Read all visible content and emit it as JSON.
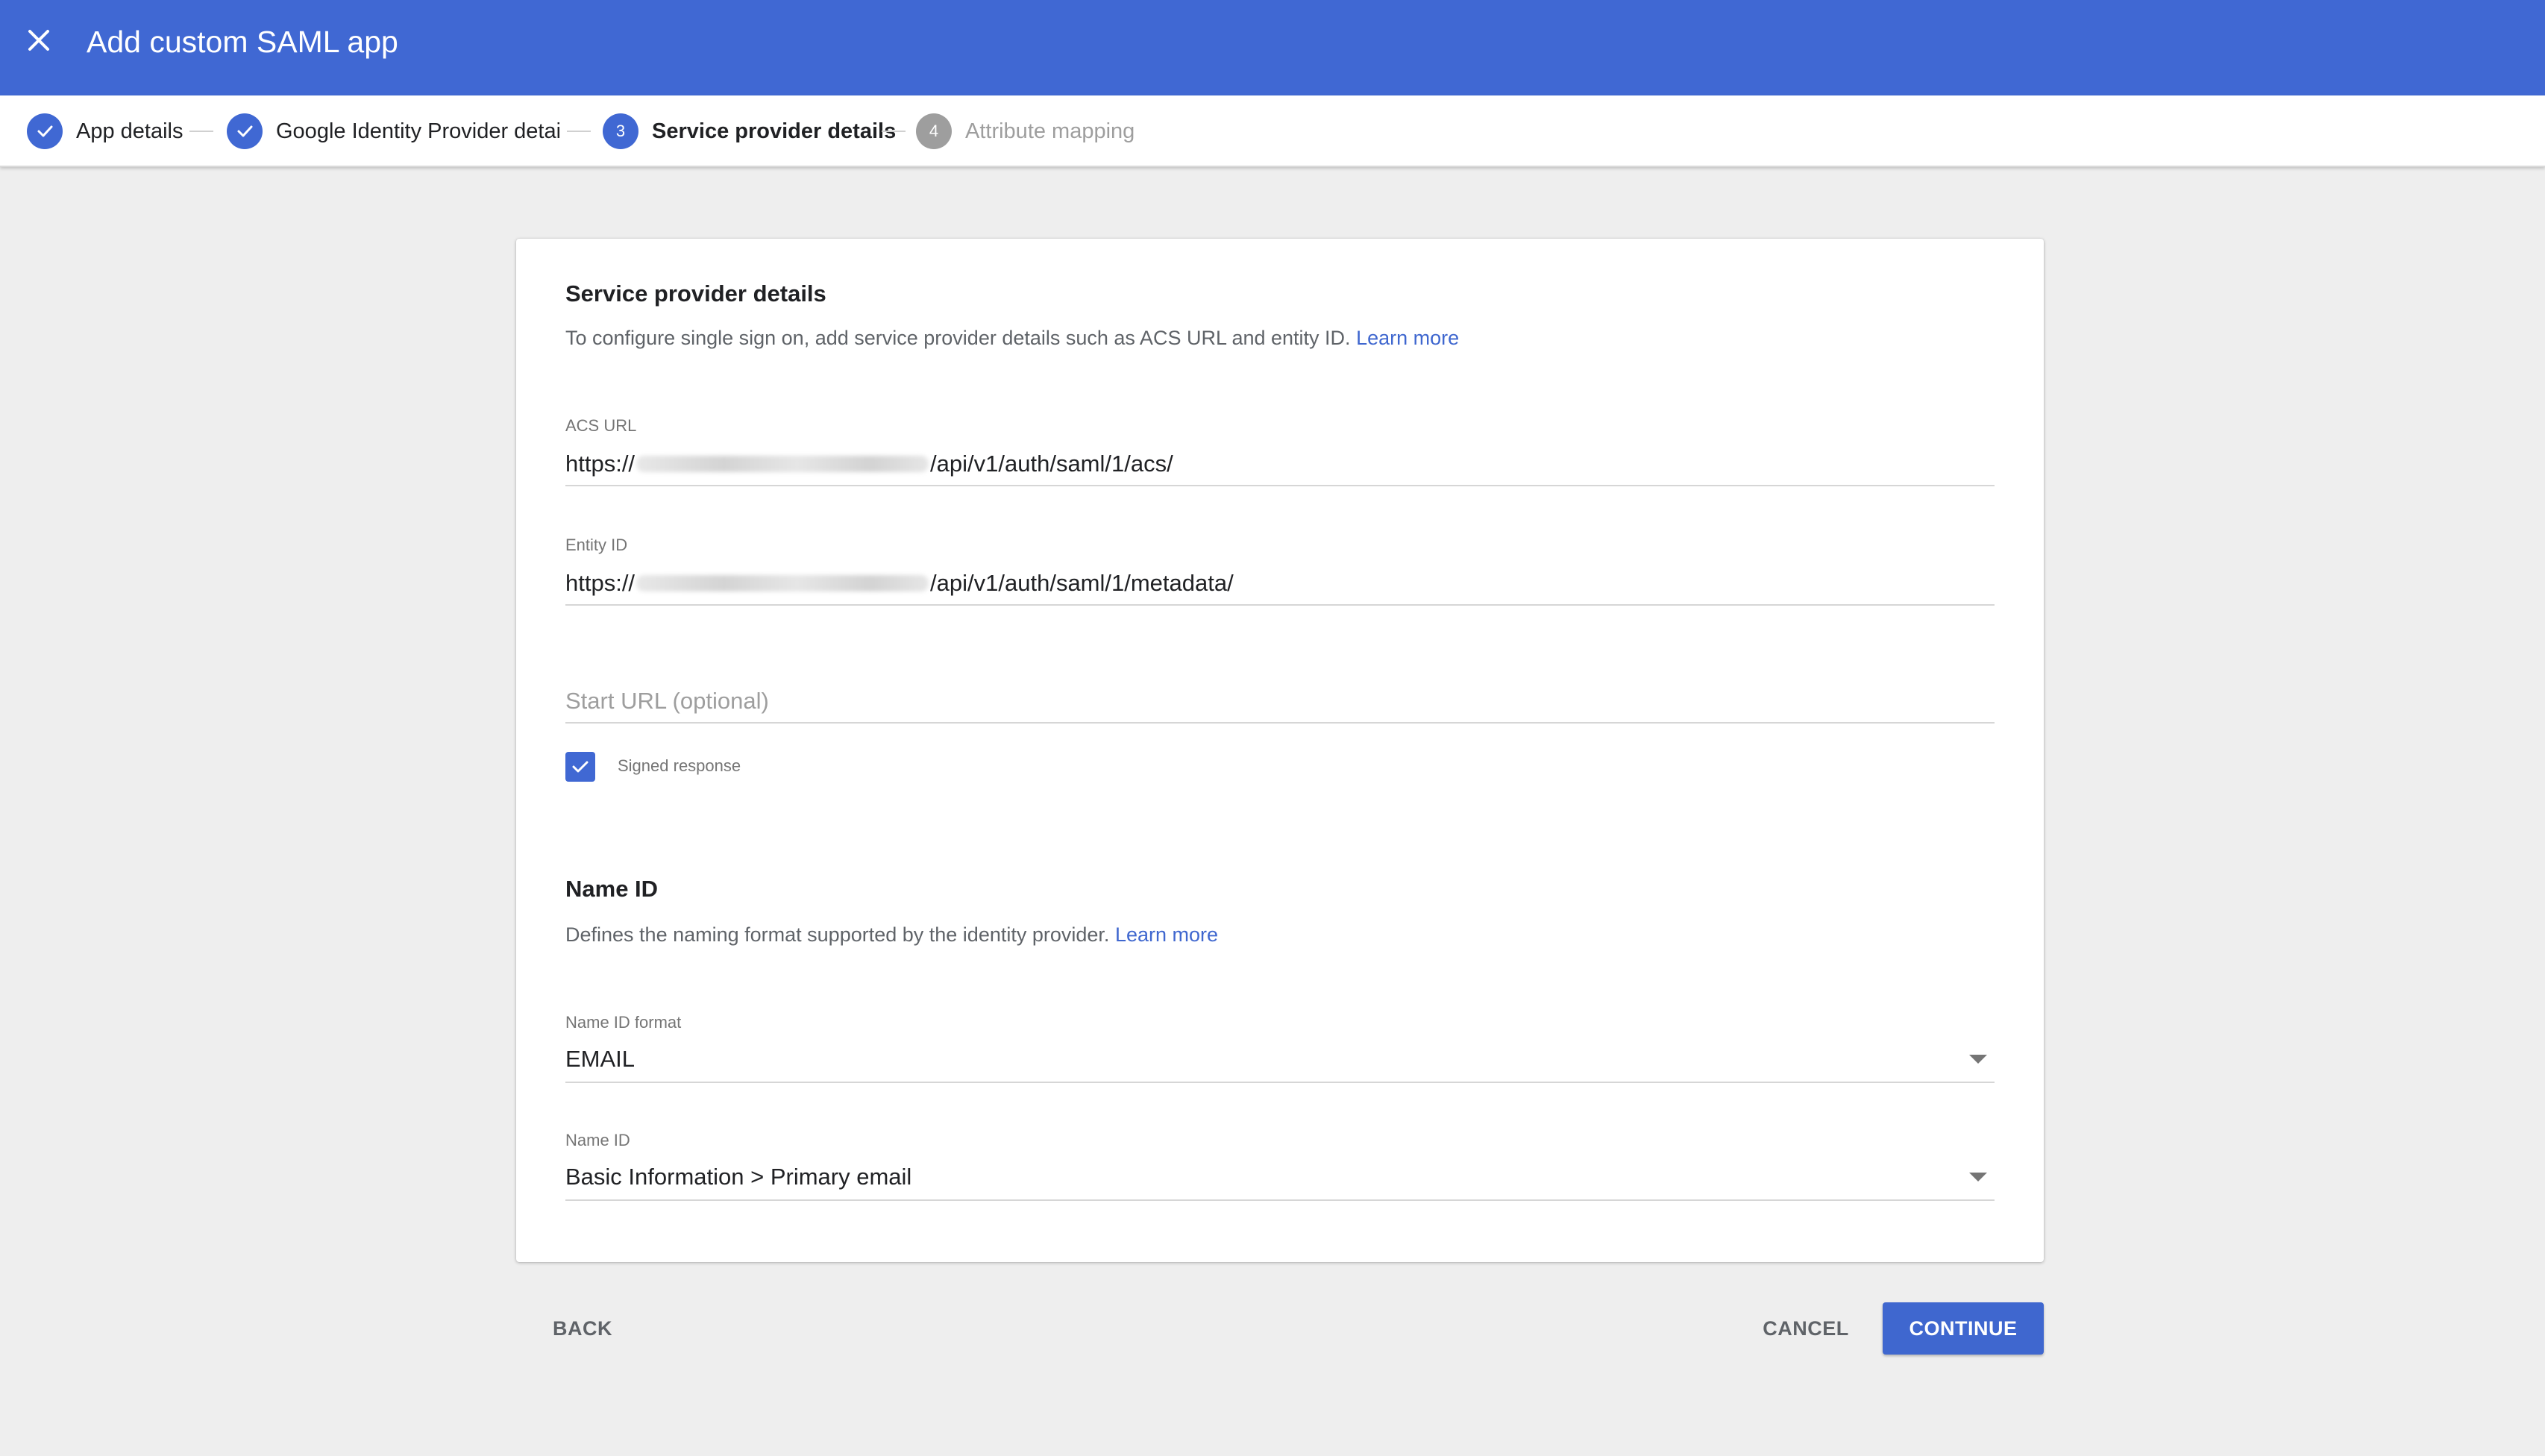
{
  "header": {
    "title": "Add custom SAML app",
    "close_icon": "close-icon",
    "color": "#4068d3"
  },
  "stepper": {
    "steps": [
      {
        "label": "App details",
        "state": "completed",
        "icon": "check-icon"
      },
      {
        "label": "Google Identity Provider details",
        "state": "completed",
        "icon": "check-icon"
      },
      {
        "label": "Service provider details",
        "state": "active",
        "number": "3"
      },
      {
        "label": "Attribute mapping",
        "state": "upcoming",
        "number": "4"
      }
    ]
  },
  "card": {
    "title": "Service provider details",
    "description": "To configure single sign on, add service provider details such as ACS URL and entity ID.",
    "learn_more": "Learn more",
    "acs_url": {
      "label": "ACS URL",
      "prefix": "https://",
      "suffix": "/api/v1/auth/saml/1/acs/"
    },
    "entity_id": {
      "label": "Entity ID",
      "prefix": "https://",
      "suffix": "/api/v1/auth/saml/1/metadata/"
    },
    "start_url": {
      "placeholder": "Start URL (optional)"
    },
    "signed_response": {
      "label": "Signed response",
      "checked": true
    },
    "name_id_section": {
      "title": "Name ID",
      "description": "Defines the naming format supported by the identity provider.",
      "learn_more": "Learn more"
    },
    "name_id_format": {
      "label": "Name ID format",
      "value": "EMAIL"
    },
    "name_id": {
      "label": "Name ID",
      "value": "Basic Information > Primary email"
    }
  },
  "footer": {
    "back": "BACK",
    "cancel": "CANCEL",
    "continue": "CONTINUE"
  }
}
